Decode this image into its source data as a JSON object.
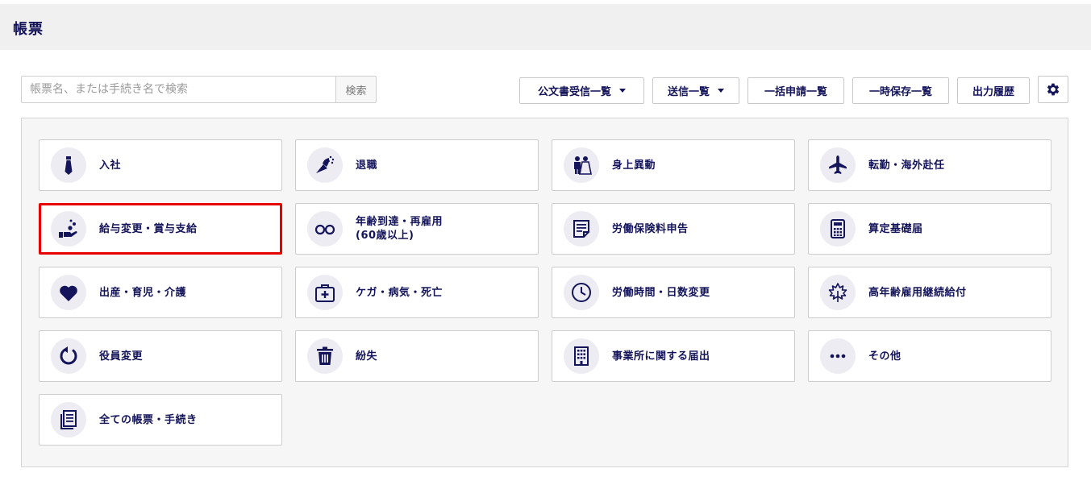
{
  "header": {
    "title": "帳票"
  },
  "search": {
    "placeholder": "帳票名、または手続き名で検索",
    "button_label": "検索"
  },
  "toolbar": {
    "public_docs_label": "公文書受信一覧",
    "sent_label": "送信一覧",
    "bulk_label": "一括申請一覧",
    "temp_label": "一時保存一覧",
    "history_label": "出力履歴"
  },
  "cards": [
    {
      "label": "入社",
      "icon": "necktie-icon"
    },
    {
      "label": "退職",
      "icon": "bouquet-icon"
    },
    {
      "label": "身上異動",
      "icon": "wedding-couple-icon"
    },
    {
      "label": "転勤・海外赴任",
      "icon": "airplane-icon"
    },
    {
      "label": "給与変更・賞与支給",
      "icon": "hand-coins-icon",
      "selected": true
    },
    {
      "label": "年齢到達・再雇用\n(60歳以上)",
      "icon": "glasses-icon"
    },
    {
      "label": "労働保険料申告",
      "icon": "document-icon"
    },
    {
      "label": "算定基礎届",
      "icon": "calculator-icon"
    },
    {
      "label": "出産・育児・介護",
      "icon": "heart-icon"
    },
    {
      "label": "ケガ・病気・死亡",
      "icon": "first-aid-kit-icon"
    },
    {
      "label": "労働時間・日数変更",
      "icon": "clock-icon"
    },
    {
      "label": "高年齢雇用継続給付",
      "icon": "maple-leaf-icon"
    },
    {
      "label": "役員変更",
      "icon": "refresh-icon"
    },
    {
      "label": "紛失",
      "icon": "trash-icon"
    },
    {
      "label": "事業所に関する届出",
      "icon": "office-building-icon"
    },
    {
      "label": "その他",
      "icon": "more-dots-icon"
    },
    {
      "label": "全ての帳票・手続き",
      "icon": "documents-icon"
    }
  ],
  "colors": {
    "navy": "#14145a",
    "highlight": "#e60000",
    "icon_bg": "#ececf2"
  }
}
